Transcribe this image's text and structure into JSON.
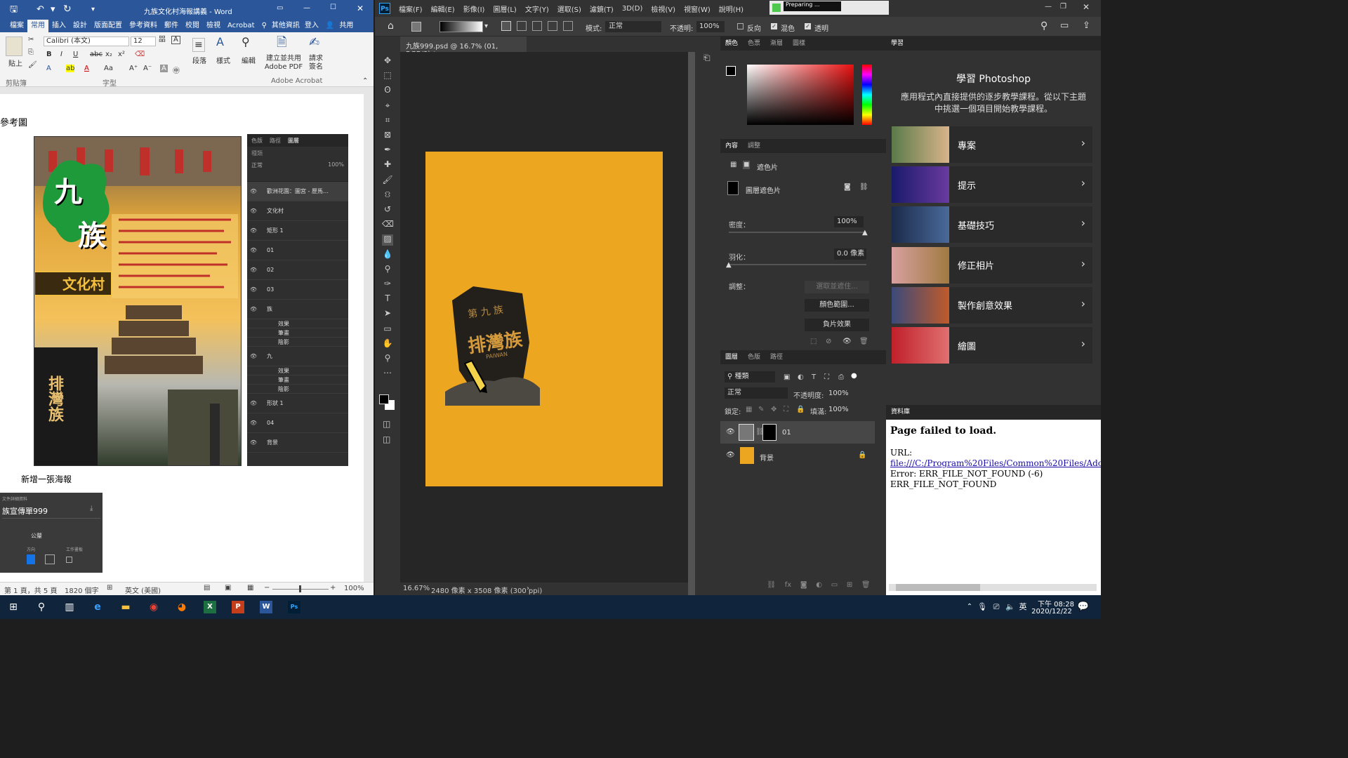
{
  "word": {
    "title": "九族文化村海報講義 - Word",
    "quick_symbol": "▾",
    "tabs": [
      "檔案",
      "常用",
      "插入",
      "設計",
      "版面配置",
      "參考資料",
      "郵件",
      "校閱",
      "檢視",
      "Acrobat"
    ],
    "tell_me": "其他資訊",
    "sign_in": "登入",
    "share": "共用",
    "ribbon": {
      "paste": "貼上",
      "clipboard": "剪貼簿",
      "font_name": "Calibri (本文)",
      "font_size": "12",
      "font_group": "字型",
      "paragraph": "段落",
      "styles": "樣式",
      "editing": "編輯",
      "create_pdf": "建立並共用 Adobe PDF",
      "request_sign": "請求 簽名",
      "acrobat_group": "Adobe Acrobat"
    },
    "doc": {
      "heading": "參考圖",
      "poster_title_1": "九",
      "poster_title_2": "族",
      "poster_banner": "文化村",
      "mini_layers": [
        "歡洲花園：圖宮 - 歷馬…",
        "文化村",
        "矩形 1",
        "01",
        "02",
        "03",
        "族",
        "效果",
        "筆畫",
        "陰影",
        "九",
        "效果",
        "筆畫",
        "陰影",
        "形狀 1",
        "04",
        "背景"
      ],
      "mini_mode": "正常",
      "mini_opacity": "100%",
      "caption": "新增一張海報",
      "dialog_label": "文件詳細資料",
      "dialog_name": "族宣傳單999",
      "dialog_unit": "公釐",
      "dialog_orient": "方向",
      "dialog_artboard": "工作畫板"
    },
    "status": {
      "page": "第 1 頁，共 5 頁",
      "words": "1820 個字",
      "lang": "英文 (美國)",
      "zoom": "100%"
    }
  },
  "ps": {
    "menu": [
      "檔案(F)",
      "編輯(E)",
      "影像(I)",
      "圖層(L)",
      "文字(Y)",
      "選取(S)",
      "濾鏡(T)",
      "3D(D)",
      "檢視(V)",
      "視窗(W)",
      "說明(H)"
    ],
    "preparing": "Preparing ...",
    "opts": {
      "mode_label": "模式:",
      "mode": "正常",
      "opacity_label": "不透明:",
      "opacity": "100%",
      "reverse": "反向",
      "dither": "混色",
      "transparency": "透明"
    },
    "doc_tab": "九族999.psd @ 16.7% (01, RGB/8) *",
    "status": {
      "zoom": "16.67%",
      "size": "2480 像素 x 3508 像素 (300 ppi)"
    },
    "color_tabs": [
      "顏色",
      "色票",
      "漸層",
      "圖樣"
    ],
    "props_tabs": [
      "內容",
      "調整"
    ],
    "props": {
      "mask_type": "遮色片",
      "layer_mask": "圖層遮色片",
      "density_label": "密度：",
      "density": "100%",
      "feather_label": "羽化：",
      "feather": "0.0 像素",
      "refine_label": "調整：",
      "select_mask": "選取並遮住...",
      "color_range": "顏色範圍...",
      "invert": "負片效果"
    },
    "layers_tabs": [
      "圖層",
      "色版",
      "路徑"
    ],
    "layers": {
      "kind": "種類",
      "blend": "正常",
      "opacity_label": "不透明度:",
      "opacity": "100%",
      "lock_label": "鎖定:",
      "fill_label": "填滿:",
      "fill": "100%",
      "rows": [
        {
          "name": "01"
        },
        {
          "name": "背景"
        }
      ]
    },
    "learn": {
      "tab": "學習",
      "title": "學習 Photoshop",
      "desc": "應用程式內直接提供的逐步教學課程。從以下主題中挑選一個項目開始教學課程。",
      "items": [
        "專案",
        "提示",
        "基礎技巧",
        "修正相片",
        "製作創意效果",
        "繪圖"
      ]
    },
    "library": {
      "tab": "資料庫",
      "error_title": "Page failed to load.",
      "url_label": "URL:",
      "url": "file:///C:/Program%20Files/Common%20Files/Adobe/C",
      "error_line": "Error: ERR_FILE_NOT_FOUND (-6)",
      "error_code": "ERR_FILE_NOT_FOUND"
    },
    "canvas_text": "排灣族",
    "canvas_sub": "PAIWAN",
    "canvas_top": "第 九 族"
  },
  "taskbar": {
    "time": "下午 08:28",
    "date": "2020/12/22",
    "ime": "英"
  },
  "colors": {
    "word_blue": "#2b579a",
    "ps_bg": "#535353",
    "canvas_orange": "#eda61f",
    "taskbar": "#10243b"
  }
}
